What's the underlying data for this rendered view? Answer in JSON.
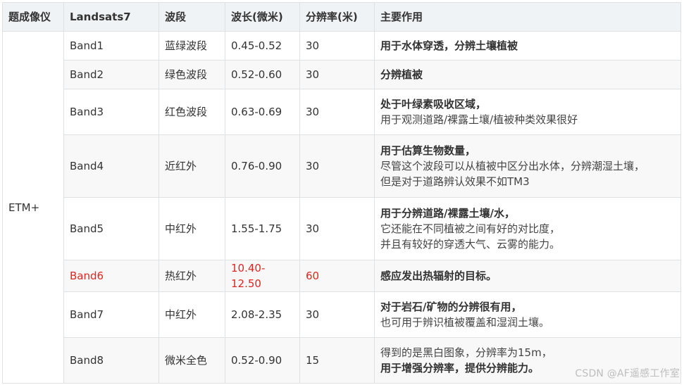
{
  "headers": [
    "题成像仪",
    "Landsats7",
    "波段",
    "波长(微米)",
    "分辨率(米)",
    "主要作用"
  ],
  "instrument": "ETM+",
  "rows": [
    {
      "band": "Band1",
      "name": "蓝绿波段",
      "wavelength": "0.45-0.52",
      "resolution": "30",
      "use_bold": "用于水体穿透，分辨土壤植被",
      "use_lines": []
    },
    {
      "band": "Band2",
      "name": "绿色波段",
      "wavelength": "0.52-0.60",
      "resolution": "30",
      "use_bold": "分辨植被",
      "use_lines": []
    },
    {
      "band": "Band3",
      "name": "红色波段",
      "wavelength": "0.63-0.69",
      "resolution": "30",
      "use_bold": "处于叶绿素吸收区域，",
      "use_lines": [
        "用于观测道路/裸露土壤/植被种类效果很好"
      ]
    },
    {
      "band": "Band4",
      "name": "近红外",
      "wavelength": "0.76-0.90",
      "resolution": "30",
      "use_bold": "用于估算生物数量，",
      "use_lines": [
        "尽管这个波段可以从植被中区分出水体，分辨潮湿土壤，",
        "但是对于道路辨认效果不如TM3"
      ]
    },
    {
      "band": "Band5",
      "name": "中红外",
      "wavelength": "1.55-1.75",
      "resolution": "30",
      "use_bold": "用于分辨道路/裸露土壤/水，",
      "use_lines": [
        "它还能在不同植被之间有好的对比度，",
        "并且有较好的穿透大气、云雾的能力。"
      ]
    },
    {
      "band": "Band6",
      "name": "热红外",
      "wavelength": "10.40-12.50",
      "resolution": "60",
      "use_bold": "感应发出热辐射的目标。",
      "use_lines": [],
      "highlight_color": "#e0261f"
    },
    {
      "band": "Band7",
      "name": "中红外",
      "wavelength": "2.08-2.35",
      "resolution": "30",
      "use_bold": "对于岩石/矿物的分辨很有用，",
      "use_lines": [
        "也可用于辨识植被覆盖和湿润土壤。"
      ]
    },
    {
      "band": "Band8",
      "name": "微米全色",
      "wavelength": "0.52-0.90",
      "resolution": "15",
      "use_pre": "得到的是黑白图象，分辨率为15m，",
      "use_bold": "用于增强分辨率，提供分辨能力。",
      "use_lines": []
    }
  ],
  "watermark": "CSDN @AF遥感工作室"
}
